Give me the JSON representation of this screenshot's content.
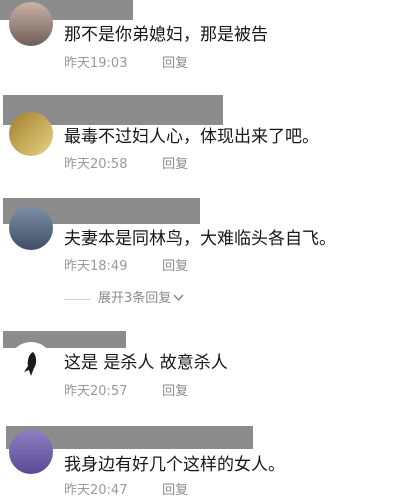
{
  "comments": [
    {
      "text": "那不是你弟媳妇，那是被告",
      "time": "昨天19:03",
      "reply": "回复"
    },
    {
      "text": "最毒不过妇人心，体现出来了吧。",
      "time": "昨天20:58",
      "reply": "回复"
    },
    {
      "text": "夫妻本是同林鸟，大难临头各自飞。",
      "time": "昨天18:49",
      "reply": "回复",
      "expand_label": "展开3条回复",
      "expand_icon": "chevron-down-icon"
    },
    {
      "text": "这是 是杀人 故意杀人",
      "time": "昨天20:57",
      "reply": "回复"
    },
    {
      "text": "我身边有好几个这样的女人。",
      "time": "昨天20:47",
      "reply": "回复"
    }
  ],
  "colors": {
    "text": "#161616",
    "meta": "#9a9a9a",
    "redaction": "#8c8c8c"
  }
}
